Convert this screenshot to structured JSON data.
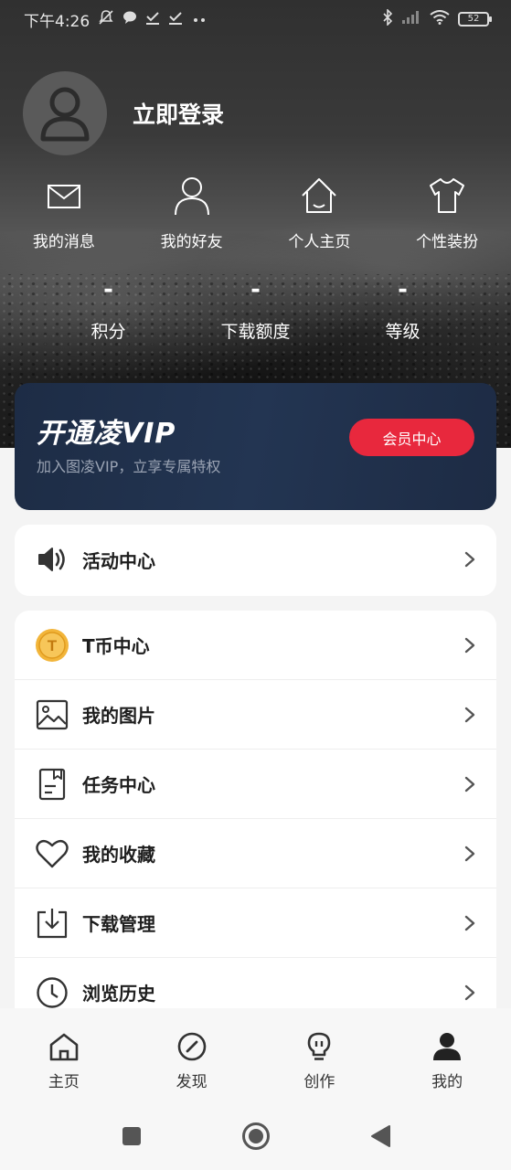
{
  "status_bar": {
    "time": "下午4:26",
    "battery": "52"
  },
  "profile": {
    "login_text": "立即登录"
  },
  "quick_actions": [
    {
      "label": "我的消息",
      "icon": "mail-icon"
    },
    {
      "label": "我的好友",
      "icon": "person-icon"
    },
    {
      "label": "个人主页",
      "icon": "home-icon"
    },
    {
      "label": "个性装扮",
      "icon": "shirt-icon"
    }
  ],
  "stats": [
    {
      "value": "-",
      "label": "积分"
    },
    {
      "value": "-",
      "label": "下载额度"
    },
    {
      "value": "-",
      "label": "等级"
    }
  ],
  "vip": {
    "title": "开通凌VIP",
    "subtitle": "加入图凌VIP，立享专属特权",
    "button": "会员中心"
  },
  "activity": {
    "label": "活动中心",
    "icon": "speaker-icon"
  },
  "menu": [
    {
      "label": "T币中心",
      "icon": "coin-icon",
      "coin_letter": "T"
    },
    {
      "label": "我的图片",
      "icon": "image-icon"
    },
    {
      "label": "任务中心",
      "icon": "task-icon"
    },
    {
      "label": "我的收藏",
      "icon": "heart-icon"
    },
    {
      "label": "下载管理",
      "icon": "download-icon"
    },
    {
      "label": "浏览历史",
      "icon": "clock-icon"
    }
  ],
  "tabs": [
    {
      "label": "主页",
      "icon": "home-icon"
    },
    {
      "label": "发现",
      "icon": "compass-icon"
    },
    {
      "label": "创作",
      "icon": "bulb-icon"
    },
    {
      "label": "我的",
      "icon": "user-icon",
      "active": true
    }
  ],
  "colors": {
    "accent_red": "#e8283d",
    "vip_card": "#1d2c45",
    "coin_gold": "#f0b030"
  }
}
